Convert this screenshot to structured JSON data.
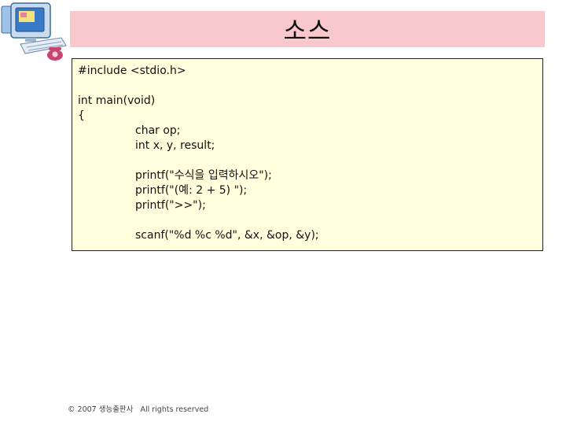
{
  "slide": {
    "title": "소스",
    "code_lines": [
      {
        "text": "#include <stdio.h>",
        "indent": false
      },
      {
        "text": "",
        "indent": false
      },
      {
        "text": "int main(void)",
        "indent": false
      },
      {
        "text": "{",
        "indent": false
      },
      {
        "text": "char op;",
        "indent": true
      },
      {
        "text": "int x, y, result;",
        "indent": true
      },
      {
        "text": "",
        "indent": false
      },
      {
        "text": "printf(\"수식을 입력하시오\");",
        "indent": true
      },
      {
        "text": "printf(\"(예: 2 + 5) \");",
        "indent": true
      },
      {
        "text": "printf(\">>\");",
        "indent": true
      },
      {
        "text": "",
        "indent": false
      },
      {
        "text": "scanf(\"%d %c %d\", &x, &op, &y);",
        "indent": true
      }
    ],
    "footer": {
      "copyright": "© 2007 생능출판사",
      "rights": "All rights reserved"
    }
  },
  "colors": {
    "title_bg": "#f9c8cc",
    "code_bg": "#ffffde"
  },
  "icons": {
    "clipart": "computer-clipart-icon"
  }
}
